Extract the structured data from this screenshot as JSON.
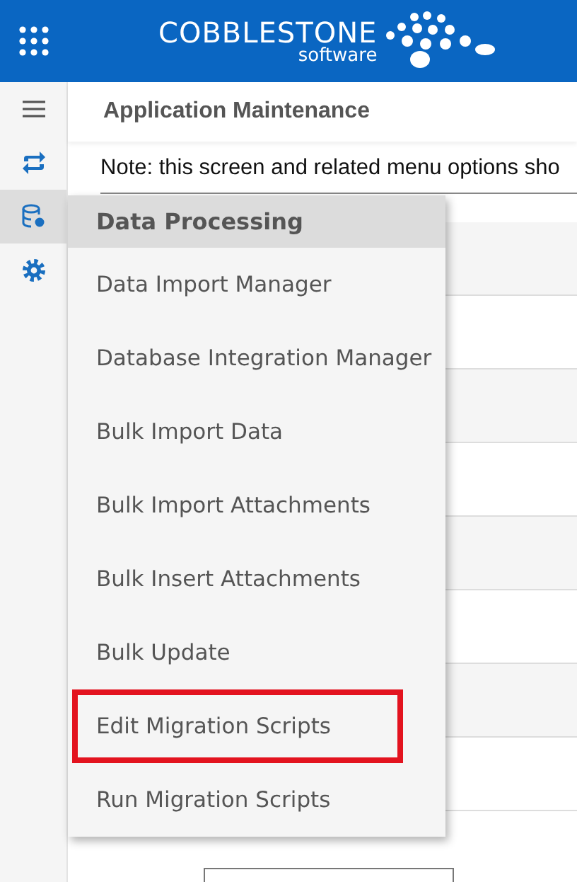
{
  "header": {
    "logo": {
      "name": "COBBLESTONE",
      "tagline": "software"
    }
  },
  "sidebar": {
    "items": [
      {
        "kind": "menu",
        "selected": false
      },
      {
        "kind": "sync",
        "selected": false
      },
      {
        "kind": "database",
        "selected": true
      },
      {
        "kind": "gear",
        "selected": false
      }
    ]
  },
  "page": {
    "title": "Application Maintenance",
    "note": "Note: this screen and related menu options sho"
  },
  "menu": {
    "title": "Data Processing",
    "items": [
      {
        "label": "Data Import Manager",
        "highlighted": false
      },
      {
        "label": "Database Integration Manager",
        "highlighted": false
      },
      {
        "label": "Bulk Import Data",
        "highlighted": false
      },
      {
        "label": "Bulk Import Attachments",
        "highlighted": false
      },
      {
        "label": "Bulk Insert Attachments",
        "highlighted": false
      },
      {
        "label": "Bulk Update",
        "highlighted": false
      },
      {
        "label": "Edit Migration Scripts",
        "highlighted": true
      },
      {
        "label": "Run Migration Scripts",
        "highlighted": false
      }
    ]
  }
}
